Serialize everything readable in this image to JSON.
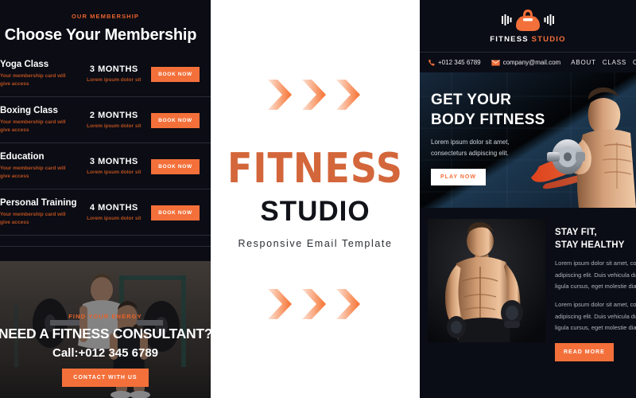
{
  "colors": {
    "orange": "#f4703a",
    "dark_bg": "#0b0c14",
    "panel_bg": "#0b0d16",
    "white": "#ffffff",
    "muted_text": "#aeb3bd",
    "brand_brush": "#d3663a"
  },
  "left_panel": {
    "eyebrow": "OUR MEMBERSHIP",
    "title": "Choose Your Membership",
    "rows": [
      {
        "name": "Yoga Class",
        "desc_line1": "Your membership card will",
        "desc_line2": "give access",
        "duration": "3 MONTHS",
        "sub": "Lorem ipsum dolor sit",
        "button": "BOOK NOW"
      },
      {
        "name": "Boxing Class",
        "desc_line1": "Your membership card will",
        "desc_line2": "give access",
        "duration": "2 MONTHS",
        "sub": "Lorem ipsum dolor sit",
        "button": "BOOK NOW"
      },
      {
        "name": "Education",
        "desc_line1": "Your membership card will",
        "desc_line2": "give access",
        "duration": "3 MONTHS",
        "sub": "Lorem ipsum dolor sit",
        "button": "BOOK NOW"
      },
      {
        "name": "Personal Training",
        "desc_line1": "Your membership card will",
        "desc_line2": "give access",
        "duration": "4 MONTHS",
        "sub": "Lorem ipsum dolor sit",
        "button": "BOOK NOW"
      }
    ],
    "consultant": {
      "eyebrow": "FIND YOUR ENERGY",
      "title": "NEED A FITNESS CONSULTANT?",
      "phone": "Call:+012 345 6789",
      "button": "CONTACT WITH US"
    }
  },
  "center_panel": {
    "brand_top": "FITNESS",
    "brand_bottom": "STUDIO",
    "subtitle": "Responsive Email Template",
    "chevron_count": 3
  },
  "right_panel": {
    "brand_white": "FITNESS",
    "brand_orange": "STUDIO",
    "contact": {
      "phone": "+012 345 6789",
      "email": "company@mail.com"
    },
    "nav": [
      "ABOUT",
      "CLASS",
      "CO"
    ],
    "hero": {
      "title_line1": "GET YOUR",
      "title_line2": "BODY FITNESS",
      "para_line1": "Lorem ipsum dolor sit amet,",
      "para_line2": "consecteturs adipiscing elit.",
      "button": "PLAY NOW"
    },
    "stay": {
      "title_line1": "STAY FIT,",
      "title_line2": "STAY HEALTHY",
      "para1_line1": "Lorem ipsum dolor sit amet, con",
      "para1_line2": "adipiscing elit. Duis vehicula dui",
      "para1_line3": "ligula cursus, eget molestie diam",
      "para2_line1": "Lorem ipsum dolor sit amet, con",
      "para2_line2": "adipiscing elit. Duis vehicula dui",
      "para2_line3": "ligula cursus, eget molestie diam",
      "button": "READ MORE"
    }
  }
}
